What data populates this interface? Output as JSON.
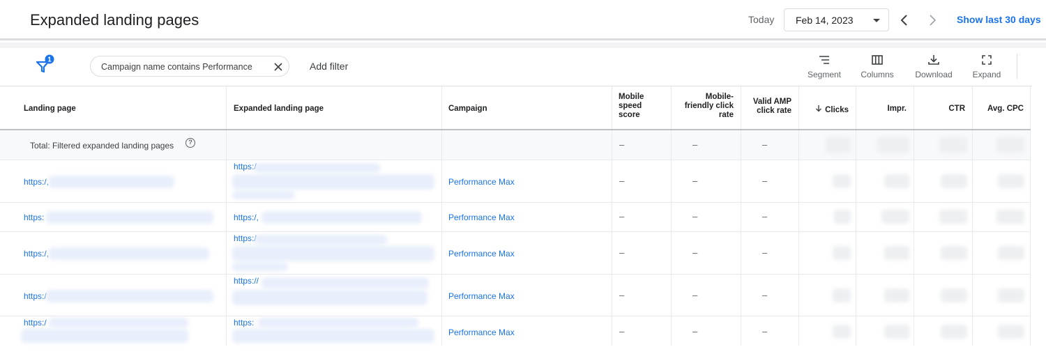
{
  "header": {
    "title": "Expanded landing pages",
    "today_label": "Today",
    "date": "Feb 14, 2023",
    "show_last": "Show last 30 days"
  },
  "filter_bar": {
    "filter_count": "1",
    "chip_label": "Campaign name contains Performance",
    "add_filter": "Add filter",
    "tools": [
      {
        "label": "Segment",
        "icon": "segment-icon"
      },
      {
        "label": "Columns",
        "icon": "columns-icon"
      },
      {
        "label": "Download",
        "icon": "download-icon"
      },
      {
        "label": "Expand",
        "icon": "expand-icon"
      }
    ]
  },
  "table": {
    "headers": {
      "landing_page": "Landing page",
      "expanded_landing_page": "Expanded landing page",
      "campaign": "Campaign",
      "mobile_speed_1": "Mobile",
      "mobile_speed_2": "speed",
      "mobile_speed_3": "score",
      "mobile_friendly_1": "Mobile-",
      "mobile_friendly_2": "friendly click",
      "mobile_friendly_3": "rate",
      "valid_amp_1": "Valid AMP",
      "valid_amp_2": "click rate",
      "clicks": "Clicks",
      "impr": "Impr.",
      "ctr": "CTR",
      "avg_cpc": "Avg. CPC"
    },
    "total_label": "Total: Filtered expanded landing pages",
    "dash": "–",
    "rows": [
      {
        "landing": "https:/,",
        "expanded": "https:/",
        "campaign": "Performance Max"
      },
      {
        "landing": "https:",
        "expanded": "https:/,",
        "campaign": "Performance Max"
      },
      {
        "landing": "https:/,",
        "expanded": "https:/",
        "campaign": "Performance Max"
      },
      {
        "landing": "https:/",
        "expanded": "https://",
        "campaign": "Performance Max"
      },
      {
        "landing": "https:/",
        "expanded": "https:",
        "campaign": "Performance Max"
      }
    ]
  }
}
